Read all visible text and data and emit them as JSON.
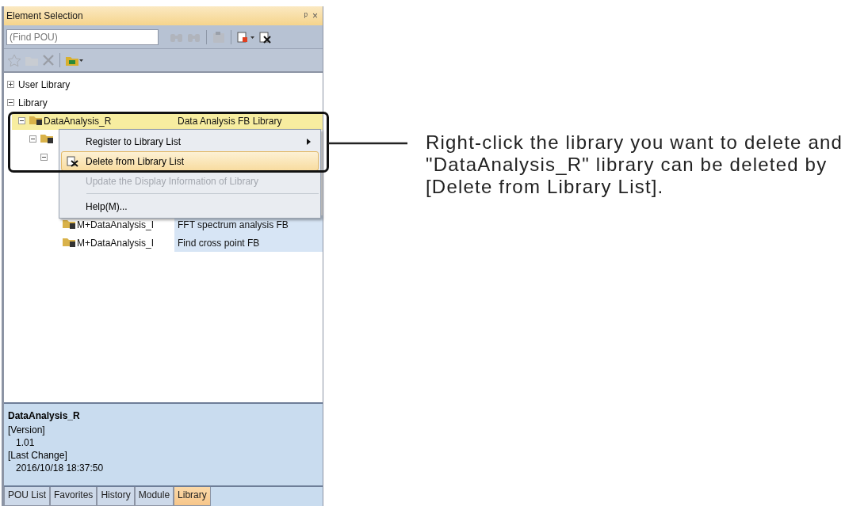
{
  "window": {
    "title": "Element Selection",
    "controls": [
      "ᵖ",
      "×"
    ]
  },
  "search": {
    "placeholder": "(Find POU)"
  },
  "tree": [
    {
      "label": "User Library",
      "expanded": false,
      "icon": false,
      "selected": false
    },
    {
      "label": "Library",
      "expanded": true,
      "icon": false,
      "selected": false,
      "children": [
        {
          "label": "DataAnalysis_R",
          "description": "Data Analysis FB Library",
          "expanded": true,
          "icon": true,
          "selected": true,
          "children": [
            {
              "expanded": true,
              "icon": true,
              "selected": false,
              "children": [
                {
                  "expanded": true,
                  "icon": false,
                  "selected": false,
                  "children": [
                    {
                      "label": "M+DataAnalysis_I",
                      "description": "FFT spectrum analysis FB",
                      "icon": true,
                      "selected": false
                    },
                    {
                      "label": "M+DataAnalysis_I",
                      "description": "Find cross point FB",
                      "icon": true,
                      "selected": false
                    }
                  ]
                }
              ]
            }
          ]
        }
      ]
    }
  ],
  "context_menu": [
    {
      "kind": "submenu",
      "label": "Register to Library List",
      "disabled": false,
      "selected": false,
      "has_icon": false
    },
    {
      "kind": "command",
      "label": "Delete from Library List",
      "disabled": false,
      "selected": true,
      "has_icon": true
    },
    {
      "kind": "command",
      "label": "Update the Display Information of Library",
      "disabled": true,
      "selected": false,
      "has_icon": false
    },
    {
      "kind": "separator"
    },
    {
      "kind": "command",
      "label": "Help(M)...",
      "disabled": false,
      "selected": false,
      "has_icon": false
    }
  ],
  "info": {
    "title": "DataAnalysis_R",
    "lines": [
      {
        "text": "[Version]",
        "indented": false
      },
      {
        "text": "1.01",
        "indented": true
      },
      {
        "text": "[Last Change]",
        "indented": false
      },
      {
        "text": "2016/10/18 18:37:50",
        "indented": true
      }
    ]
  },
  "tabs": [
    {
      "label": "POU List",
      "selected": false
    },
    {
      "label": "Favorites",
      "selected": false
    },
    {
      "label": "History",
      "selected": false
    },
    {
      "label": "Module",
      "selected": false
    },
    {
      "label": "Library",
      "selected": true
    }
  ],
  "annotation": {
    "text": "Right-click the library you want to delete and \"DataAnalysis_R\" library can be deleted by [Delete from Library List]."
  }
}
